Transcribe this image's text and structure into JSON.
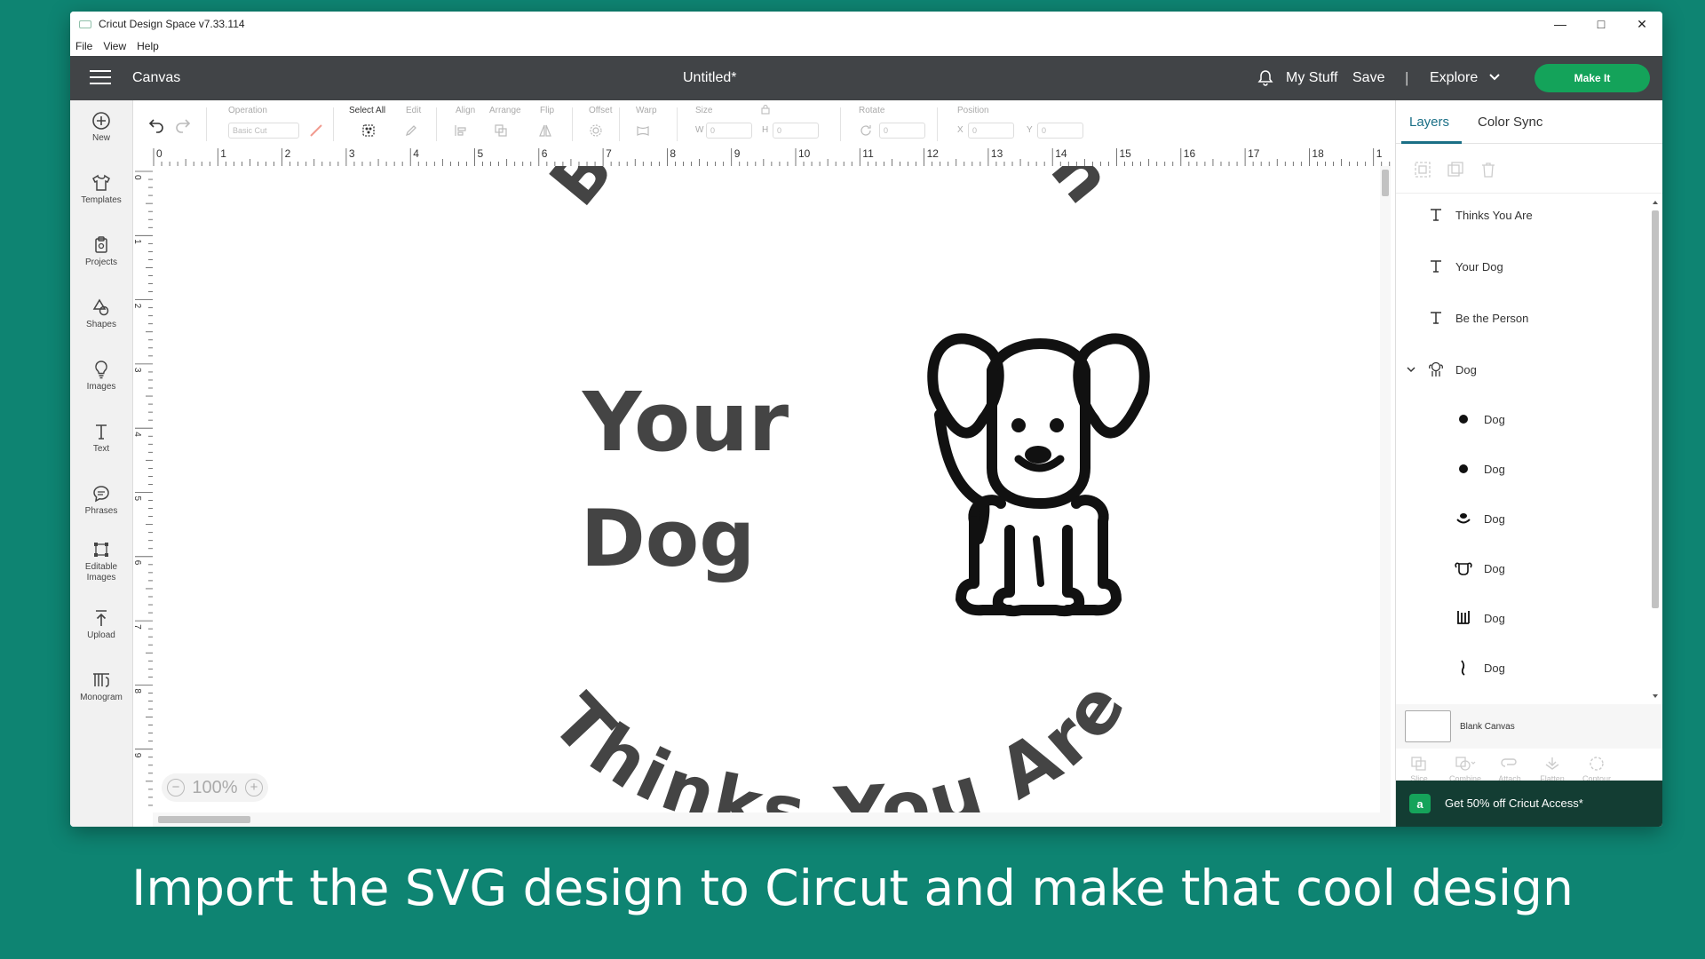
{
  "window": {
    "title": "Cricut Design Space  v7.33.114",
    "controls": [
      "—",
      "□",
      "✕"
    ]
  },
  "menubar": [
    "File",
    "View",
    "Help"
  ],
  "header": {
    "section": "Canvas",
    "document_title": "Untitled*",
    "my_stuff": "My Stuff",
    "save": "Save",
    "separator": "|",
    "explore": "Explore",
    "make_it": "Make It",
    "make_it_color": "#14a35a"
  },
  "left_toolbar": [
    {
      "label": "New",
      "icon": "plus-circle-icon"
    },
    {
      "label": "Templates",
      "icon": "shirt-icon"
    },
    {
      "label": "Projects",
      "icon": "clipboard-icon"
    },
    {
      "label": "Shapes",
      "icon": "shapes-icon"
    },
    {
      "label": "Images",
      "icon": "lightbulb-icon"
    },
    {
      "label": "Text",
      "icon": "text-icon"
    },
    {
      "label": "Phrases",
      "icon": "speech-bubble-icon"
    },
    {
      "label": "Editable Images",
      "icon": "editable-images-icon"
    },
    {
      "label": "Upload",
      "icon": "upload-icon"
    },
    {
      "label": "Monogram",
      "icon": "monogram-icon"
    }
  ],
  "edit_toolbar": {
    "operation_label": "Operation",
    "operation_value": "Basic Cut",
    "select_all": "Select All",
    "edit": "Edit",
    "align": "Align",
    "arrange": "Arrange",
    "flip": "Flip",
    "offset": "Offset",
    "warp": "Warp",
    "size": "Size",
    "w": "W",
    "w_value": "0",
    "h": "H",
    "h_value": "0",
    "rotate": "Rotate",
    "rotate_value": "0",
    "position": "Position",
    "x": "X",
    "x_value": "0",
    "y": "Y",
    "y_value": "0"
  },
  "ruler": {
    "top": [
      "0",
      "1",
      "2",
      "3",
      "4",
      "5",
      "6",
      "7",
      "8",
      "9",
      "10",
      "11",
      "12",
      "13",
      "14",
      "15",
      "16",
      "17",
      "18",
      "1"
    ],
    "left": [
      "0",
      "1",
      "2",
      "3",
      "4",
      "5",
      "6",
      "7",
      "8",
      "9"
    ]
  },
  "canvas": {
    "arc_top": "Be the Person",
    "line1": "Your",
    "line2": "Dog",
    "arc_bottom": "Thinks You Are",
    "zoom": "100%"
  },
  "right_panel": {
    "tabs": [
      "Layers",
      "Color Sync"
    ],
    "layers": [
      {
        "label": "Thinks You Are",
        "icon": "text-icon"
      },
      {
        "label": "Your Dog",
        "icon": "text-icon"
      },
      {
        "label": "Be the Person",
        "icon": "text-icon"
      },
      {
        "label": "Dog",
        "icon": "dog-group-icon"
      },
      {
        "label": "Dog",
        "icon": "dot-icon"
      },
      {
        "label": "Dog",
        "icon": "dot-icon"
      },
      {
        "label": "Dog",
        "icon": "mouth-icon"
      },
      {
        "label": "Dog",
        "icon": "dog-head-icon"
      },
      {
        "label": "Dog",
        "icon": "legs-icon"
      },
      {
        "label": "Dog",
        "icon": "tail-icon"
      }
    ],
    "blank_canvas": "Blank Canvas",
    "bottom_tools": [
      "Slice",
      "Combine",
      "Attach",
      "Flatten",
      "Contour"
    ],
    "promo": "Get 50% off Cricut Access*",
    "promo_badge": "a"
  },
  "caption": "Import the SVG design to Circut and make that cool design"
}
